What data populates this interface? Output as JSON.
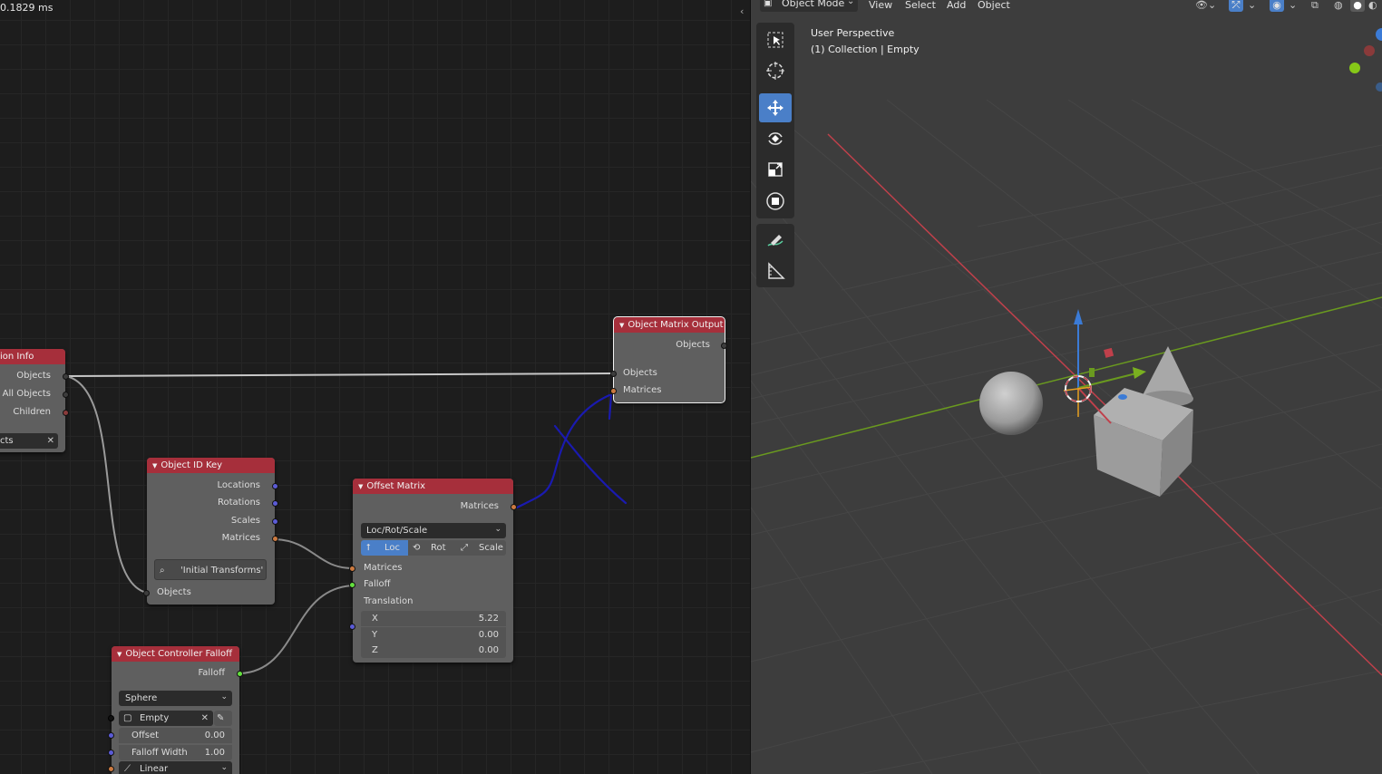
{
  "node_editor": {
    "timing": "0.1829 ms",
    "collapse_glyph": "‹",
    "collection_info_node": {
      "title": "ion Info",
      "outputs": [
        "Objects",
        "All Objects",
        "Children"
      ],
      "field_text": "cts"
    },
    "object_matrix_output_node": {
      "title": "Object Matrix Output",
      "output": "Objects",
      "inputs": [
        "Objects",
        "Matrices"
      ]
    },
    "object_id_key_node": {
      "title": "Object ID Key",
      "outputs": [
        "Locations",
        "Rotations",
        "Scales",
        "Matrices"
      ],
      "key_name": "'Initial Transforms'",
      "input": "Objects"
    },
    "offset_matrix_node": {
      "title": "Offset Matrix",
      "output": "Matrices",
      "mode": "Loc/Rot/Scale",
      "toggles": [
        "Loc",
        "Rot",
        "Scale"
      ],
      "active_toggle": "Loc",
      "inputs": [
        "Matrices",
        "Falloff"
      ],
      "translation_label": "Translation",
      "translation": [
        {
          "axis": "X",
          "value": "5.22"
        },
        {
          "axis": "Y",
          "value": "0.00"
        },
        {
          "axis": "Z",
          "value": "0.00"
        }
      ]
    },
    "object_controller_falloff_node": {
      "title": "Object Controller Falloff",
      "output": "Falloff",
      "shape": "Sphere",
      "object": "Empty",
      "offset_label": "Offset",
      "offset_value": "0.00",
      "falloff_width_label": "Falloff Width",
      "falloff_width_value": "1.00",
      "interpolation": "Linear"
    }
  },
  "viewport": {
    "header": {
      "mode": "Object Mode",
      "menus": [
        "View",
        "Select",
        "Add",
        "Object"
      ]
    },
    "info_line1": "User Perspective",
    "info_line2": "(1) Collection | Empty",
    "tools": [
      "select-box",
      "cursor",
      "move",
      "rotate",
      "scale",
      "transform",
      "annotate",
      "measure"
    ],
    "active_tool": "move",
    "colors": {
      "x_axis": "#c0404b",
      "y_axis": "#6a9a1f",
      "z_axis": "#3b7bd6",
      "accent": "#4a7fc8",
      "node_header": "#a62f3b"
    }
  }
}
